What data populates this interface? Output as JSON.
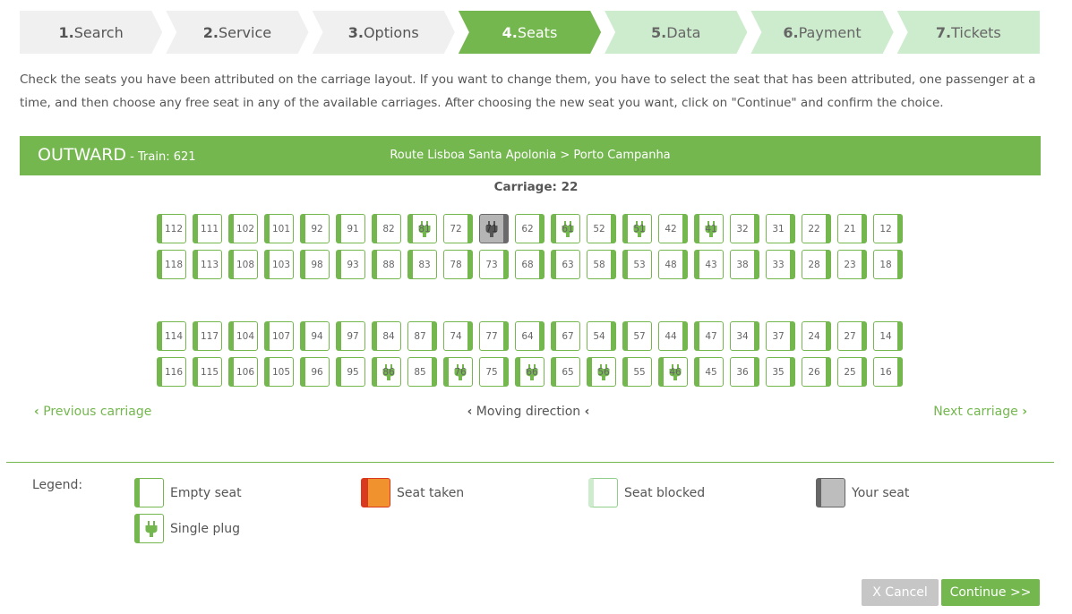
{
  "steps": [
    {
      "num": "1.",
      "label": "Search",
      "state": "done"
    },
    {
      "num": "2.",
      "label": "Service",
      "state": "done"
    },
    {
      "num": "3.",
      "label": "Options",
      "state": "done"
    },
    {
      "num": "4.",
      "label": "Seats",
      "state": "active"
    },
    {
      "num": "5.",
      "label": "Data",
      "state": "future"
    },
    {
      "num": "6.",
      "label": "Payment",
      "state": "future"
    },
    {
      "num": "7.",
      "label": "Tickets",
      "state": "future"
    }
  ],
  "intro": "Check the seats you have been attributed on the carriage layout. If you want to change them, you have to select the seat that has been attributed, one passenger at a time, and then choose any free seat in any of the available carriages. After choosing the new seat you want, click on \"Continue\" and confirm the choice.",
  "journey": {
    "direction": "OUTWARD",
    "train": " - Train: 621",
    "route": "Route Lisboa Santa Apolonia > Porto Campanha"
  },
  "carriage_label": "Carriage: 22",
  "seat_rows": [
    [
      [
        "112",
        "L",
        0,
        0
      ],
      [
        "111",
        "L",
        0,
        0
      ],
      [
        "102",
        "L",
        0,
        0
      ],
      [
        "101",
        "L",
        0,
        0
      ],
      [
        "92",
        "L",
        0,
        0
      ],
      [
        "91",
        "L",
        0,
        0
      ],
      [
        "82",
        "L",
        0,
        0
      ],
      [
        "81",
        "L",
        1,
        0
      ],
      [
        "72",
        "R",
        0,
        0
      ],
      [
        "71",
        "R",
        1,
        1
      ],
      [
        "62",
        "R",
        0,
        0
      ],
      [
        "61",
        "L",
        1,
        0
      ],
      [
        "52",
        "R",
        0,
        0
      ],
      [
        "51",
        "L",
        1,
        0
      ],
      [
        "42",
        "R",
        0,
        0
      ],
      [
        "41",
        "L",
        1,
        0
      ],
      [
        "32",
        "R",
        0,
        0
      ],
      [
        "31",
        "R",
        0,
        0
      ],
      [
        "22",
        "R",
        0,
        0
      ],
      [
        "21",
        "R",
        0,
        0
      ],
      [
        "12",
        "R",
        0,
        0
      ]
    ],
    [
      [
        "118",
        "L",
        0,
        0
      ],
      [
        "113",
        "L",
        0,
        0
      ],
      [
        "108",
        "L",
        0,
        0
      ],
      [
        "103",
        "L",
        0,
        0
      ],
      [
        "98",
        "L",
        0,
        0
      ],
      [
        "93",
        "L",
        0,
        0
      ],
      [
        "88",
        "L",
        0,
        0
      ],
      [
        "83",
        "L",
        0,
        0
      ],
      [
        "78",
        "R",
        0,
        0
      ],
      [
        "73",
        "R",
        0,
        0
      ],
      [
        "68",
        "R",
        0,
        0
      ],
      [
        "63",
        "L",
        0,
        0
      ],
      [
        "58",
        "R",
        0,
        0
      ],
      [
        "53",
        "L",
        0,
        0
      ],
      [
        "48",
        "R",
        0,
        0
      ],
      [
        "43",
        "L",
        0,
        0
      ],
      [
        "38",
        "R",
        0,
        0
      ],
      [
        "33",
        "R",
        0,
        0
      ],
      [
        "28",
        "R",
        0,
        0
      ],
      [
        "23",
        "R",
        0,
        0
      ],
      [
        "18",
        "R",
        0,
        0
      ]
    ],
    [
      [
        "114",
        "L",
        0,
        0
      ],
      [
        "117",
        "L",
        0,
        0
      ],
      [
        "104",
        "L",
        0,
        0
      ],
      [
        "107",
        "L",
        0,
        0
      ],
      [
        "94",
        "L",
        0,
        0
      ],
      [
        "97",
        "L",
        0,
        0
      ],
      [
        "84",
        "L",
        0,
        0
      ],
      [
        "87",
        "R",
        0,
        0
      ],
      [
        "74",
        "R",
        0,
        0
      ],
      [
        "77",
        "R",
        0,
        0
      ],
      [
        "64",
        "R",
        0,
        0
      ],
      [
        "67",
        "L",
        0,
        0
      ],
      [
        "54",
        "R",
        0,
        0
      ],
      [
        "57",
        "L",
        0,
        0
      ],
      [
        "44",
        "R",
        0,
        0
      ],
      [
        "47",
        "L",
        0,
        0
      ],
      [
        "34",
        "R",
        0,
        0
      ],
      [
        "37",
        "R",
        0,
        0
      ],
      [
        "24",
        "R",
        0,
        0
      ],
      [
        "27",
        "R",
        0,
        0
      ],
      [
        "14",
        "R",
        0,
        0
      ]
    ],
    [
      [
        "116",
        "L",
        0,
        0
      ],
      [
        "115",
        "L",
        0,
        0
      ],
      [
        "106",
        "L",
        0,
        0
      ],
      [
        "105",
        "L",
        0,
        0
      ],
      [
        "96",
        "L",
        0,
        0
      ],
      [
        "95",
        "L",
        0,
        0
      ],
      [
        "86",
        "L",
        1,
        0
      ],
      [
        "85",
        "R",
        0,
        0
      ],
      [
        "76",
        "L",
        1,
        0
      ],
      [
        "75",
        "R",
        0,
        0
      ],
      [
        "66",
        "L",
        1,
        0
      ],
      [
        "65",
        "L",
        0,
        0
      ],
      [
        "56",
        "L",
        1,
        0
      ],
      [
        "55",
        "L",
        0,
        0
      ],
      [
        "46",
        "L",
        1,
        0
      ],
      [
        "45",
        "L",
        0,
        0
      ],
      [
        "36",
        "R",
        0,
        0
      ],
      [
        "35",
        "R",
        0,
        0
      ],
      [
        "26",
        "R",
        0,
        0
      ],
      [
        "25",
        "R",
        0,
        0
      ],
      [
        "16",
        "R",
        0,
        0
      ]
    ]
  ],
  "nav": {
    "prev": "Previous carriage",
    "moving": "Moving direction",
    "next": "Next carriage"
  },
  "legend": {
    "title": "Legend:",
    "empty": "Empty seat",
    "taken": "Seat taken",
    "blocked": "Seat blocked",
    "yours": "Your seat",
    "plug": "Single plug"
  },
  "buttons": {
    "cancel": "X Cancel",
    "continue": "Continue >>"
  },
  "colors": {
    "accent": "#74b74f",
    "step_future": "#cdeccd",
    "taken": "#f0922e",
    "your_seat": "#b5b5b5"
  }
}
